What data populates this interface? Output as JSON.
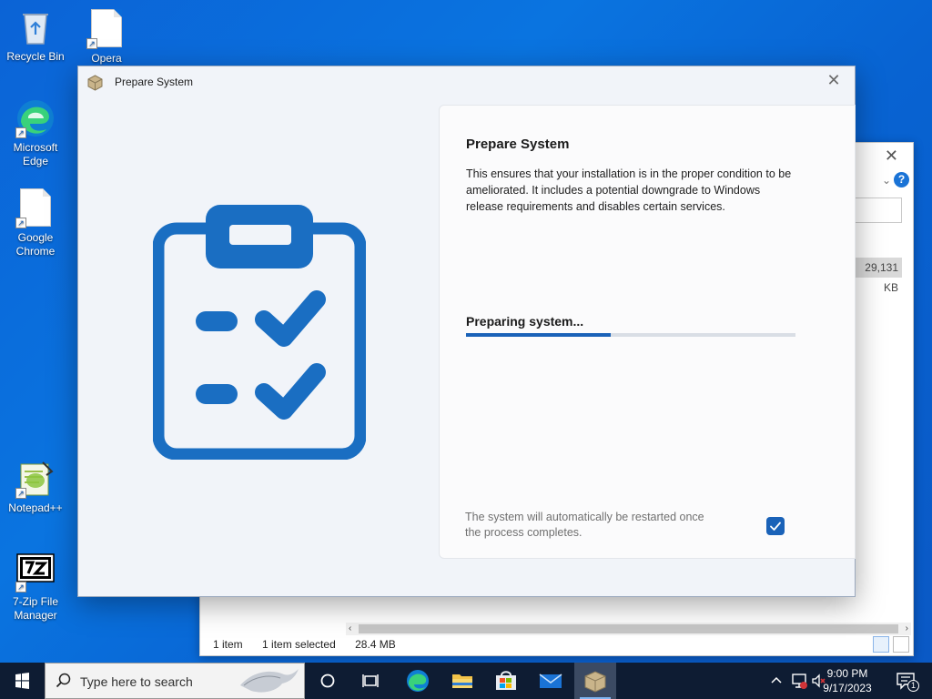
{
  "desktop": {
    "icons": [
      {
        "label": "Recycle Bin"
      },
      {
        "label": "Opera"
      },
      {
        "label_line1": "Microsoft",
        "label_line2": "Edge"
      },
      {
        "label_line1": "Google",
        "label_line2": "Chrome"
      },
      {
        "label": "Notepad++"
      },
      {
        "label_line1": "7-Zip File",
        "label_line2": "Manager"
      }
    ]
  },
  "explorer": {
    "size_value": "29,131 KB",
    "status": {
      "items": "1 item",
      "selected": "1 item selected",
      "size": "28.4 MB"
    }
  },
  "dialog": {
    "title": "Prepare System",
    "panel": {
      "heading": "Prepare System",
      "description": "This ensures that your installation is in the proper condition to be ameliorated. It includes a potential downgrade to Windows release requirements and disables certain services.",
      "progress_label": "Preparing system...",
      "progress_fraction": 0.44,
      "note": "The system will automatically be restarted once the process completes.",
      "restart_checked": true
    },
    "colors": {
      "accent": "#1a62b8",
      "illustration": "#1a6ec2"
    }
  },
  "taskbar": {
    "search_placeholder": "Type here to search",
    "time": "9:00 PM",
    "date": "9/17/2023",
    "notification_count": "1"
  }
}
